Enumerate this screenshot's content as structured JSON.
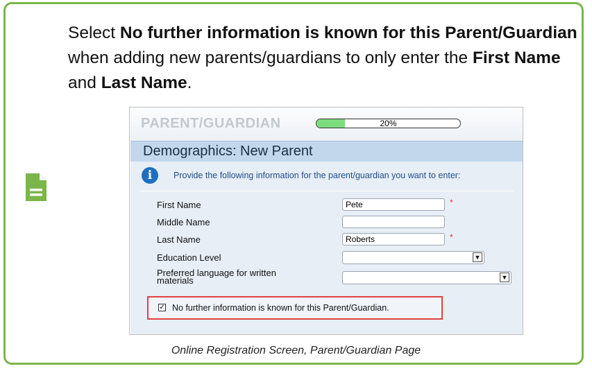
{
  "note": {
    "icon": "document-icon",
    "accent_color": "#7ab648",
    "text_1": "Select ",
    "text_2": "No further information is known for this Parent/Guardian",
    "text_3": " when adding new parents/guardians to only enter the ",
    "text_4": "First Name",
    "text_5": " and ",
    "text_6": "Last Name",
    "text_7": "."
  },
  "screen": {
    "title": "PARENT/GUARDIAN",
    "progress_percent": 20,
    "progress_label": "20%",
    "section_title": "Demographics: New Parent",
    "info_glyph": "i",
    "info_text": "Provide the following information for the parent/guardian you want to enter:",
    "fields": {
      "first_name_label": "First Name",
      "first_name_value": "Pete",
      "middle_name_label": "Middle Name",
      "middle_name_value": "",
      "last_name_label": "Last Name",
      "last_name_value": "Roberts",
      "education_label": "Education Level",
      "language_label_1": "Preferred language for written",
      "language_label_2": "materials",
      "required_mark": "*"
    },
    "checkbox": {
      "label": "No further information is known for this Parent/Guardian.",
      "checked": true,
      "mark": "✓",
      "highlight_color": "#e0413b"
    },
    "select_arrow": "▼"
  },
  "caption": "Online Registration Screen, Parent/Guardian Page"
}
